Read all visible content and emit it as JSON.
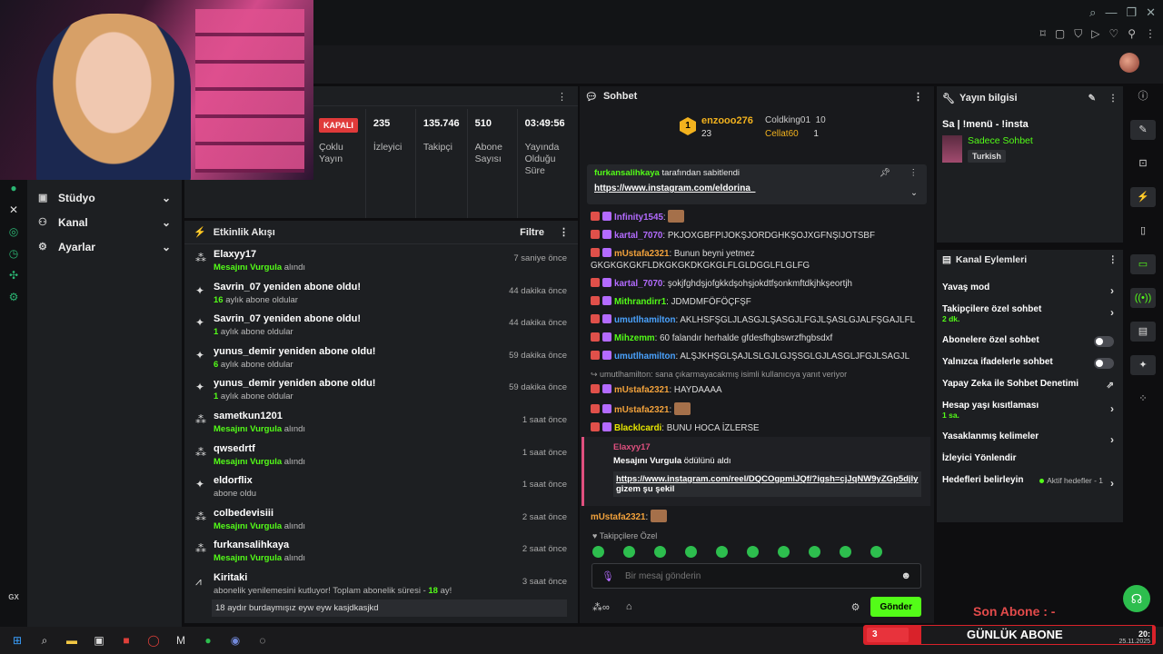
{
  "header": {
    "window_controls": [
      "search-icon",
      "minimize-icon",
      "restore-icon",
      "close-icon"
    ],
    "toolbar_icons": [
      "bookmark-icon",
      "clip-icon",
      "shield-icon",
      "play-icon",
      "heart-icon",
      "user-icon",
      "menu-icon"
    ]
  },
  "left_nav": {
    "items": [
      {
        "label": "Stüdyo",
        "icon": "video-icon"
      },
      {
        "label": "Kanal",
        "icon": "users-icon"
      },
      {
        "label": "Ayarlar",
        "icon": "gear-icon"
      }
    ],
    "rail_bottom": "GX"
  },
  "stats": {
    "status_badge": "KAPALI",
    "status_label": "Çoklu Yayın",
    "items": [
      {
        "value": "235",
        "label": "İzleyici"
      },
      {
        "value": "135.746",
        "label": "Takipçi"
      },
      {
        "value": "510",
        "label": "Abone Sayısı"
      },
      {
        "value": "03:49:56",
        "label": "Yayında Olduğu Süre"
      }
    ]
  },
  "activity": {
    "title": "Etkinlik Akışı",
    "filter_label": "Filtre",
    "rows": [
      {
        "name": "Elaxyy17",
        "hl": "Mesajını Vurgula",
        "rest": " alındı",
        "time": "7 saniye önce",
        "icon": "reward-icon"
      },
      {
        "name": "Savrin_07 yeniden abone oldu!",
        "hl": "16",
        "rest": " aylık abone oldular",
        "time": "44 dakika önce",
        "icon": "star-icon"
      },
      {
        "name": "Savrin_07 yeniden abone oldu!",
        "hl": "1",
        "rest": " aylık abone oldular",
        "time": "44 dakika önce",
        "icon": "star-icon"
      },
      {
        "name": "yunus_demir yeniden abone oldu!",
        "hl": "6",
        "rest": " aylık abone oldular",
        "time": "59 dakika önce",
        "icon": "star-icon"
      },
      {
        "name": "yunus_demir yeniden abone oldu!",
        "hl": "1",
        "rest": " aylık abone oldular",
        "time": "59 dakika önce",
        "icon": "star-icon"
      },
      {
        "name": "sametkun1201",
        "hl": "Mesajını Vurgula",
        "rest": " alındı",
        "time": "1 saat önce",
        "icon": "reward-icon"
      },
      {
        "name": "qwsedrtf",
        "hl": "Mesajını Vurgula",
        "rest": " alındı",
        "time": "1 saat önce",
        "icon": "reward-icon"
      },
      {
        "name": "eldorflix",
        "hl": "",
        "rest": "abone oldu",
        "time": "1 saat önce",
        "icon": "star-icon"
      },
      {
        "name": "colbedevisiii",
        "hl": "Mesajını Vurgula",
        "rest": " alındı",
        "time": "2 saat önce",
        "icon": "reward-icon"
      },
      {
        "name": "furkansalihkaya",
        "hl": "Mesajını Vurgula",
        "rest": " alındı",
        "time": "2 saat önce",
        "icon": "reward-icon"
      }
    ],
    "last": {
      "name": "Kiritaki",
      "text": "abonelik yenilemesini kutluyor! Toplam abonelik süresi - ",
      "months": "18",
      "suffix": " ay!",
      "time": "3 saat önce",
      "message": "18 aydır burdaymışız eyw eyw kasjdkasjkd"
    }
  },
  "chat": {
    "title": "Sohbet",
    "podium": {
      "first_rank": "1",
      "first_name": "enzooo276",
      "first_count": "23",
      "second_name": "Coldking01",
      "second_count": "10",
      "third_name": "Cellat60",
      "third_count": "1"
    },
    "pinned": {
      "author": "furkansalihkaya",
      "suffix": "tarafından sabitlendi",
      "url": "https://www.instagram.com/eldorina_"
    },
    "messages": [
      {
        "user": "Infinity1545",
        "uclass": "u-pur",
        "text": ""
      },
      {
        "user": "kartal_7070",
        "uclass": "u-pur",
        "text": "PKJOXGBFPIJOKŞJORDGHKŞOJXGFNŞIJOTSBF"
      },
      {
        "user": "mUstafa2321",
        "uclass": "u-ora",
        "text": "Bunun beyni yetmez GKGKGKGKFLDKGKGKDKGKGLFLGLDGGLFLGLFG"
      },
      {
        "user": "kartal_7070",
        "uclass": "u-pur",
        "text": "şokjfghdşjofgkkdşohşjokdtfşonkmftdkjhkşeortjh"
      },
      {
        "user": "Mithrandirr1",
        "uclass": "u-grn",
        "text": "JDMDMFÖFÖÇFŞF"
      },
      {
        "user": "umutlhamilton",
        "uclass": "u-blu",
        "text": "AKLHSFŞGLJLASGJLŞASGJLFGJLŞASLGJALFŞGAJLFL"
      },
      {
        "user": "Mihzemm",
        "uclass": "u-grn",
        "text": "60 falandır herhalde gfdesfhgbswrzfhgbsdxf"
      },
      {
        "user": "umutlhamilton",
        "uclass": "u-blu",
        "text": "ALŞJKHŞGLŞAJLSLGJLGJŞSGLGJLASGLJFGJLSAGJL"
      }
    ],
    "reply_note": "umutlhamilton: sana çıkarmayacakmış isimli kullanıcıya yanıt veriyor",
    "messages2": [
      {
        "user": "mUstafa2321",
        "uclass": "u-ora",
        "text": "HAYDAAAA"
      },
      {
        "user": "mUstafa2321",
        "uclass": "u-ora",
        "text": ""
      },
      {
        "user": "Blacklcardi",
        "uclass": "u-yel",
        "text": "BUNU HOCA İZLERSE"
      }
    ],
    "reward": {
      "user": "Elaxyy17",
      "title": "Mesajını Vurgula",
      "suffix": "ödülünü aldı",
      "url": "https://www.instagram.com/reel/DQCOgpmiJQf/?igsh=cjJqNW9yZGp5djly",
      "url_suffix": "gizem şu şekil"
    },
    "last_msg_user": "mUstafa2321",
    "follow_only": "Takipçilere Özel",
    "input_placeholder": "Bir mesaj gönderin",
    "send_label": "Gönder"
  },
  "stream_info": {
    "title": "Yayın bilgisi",
    "stream_title": "Sa | !menü - !insta",
    "category": "Sadece Sohbet",
    "tag": "Turkish"
  },
  "channel_actions": {
    "title": "Kanal Eylemleri",
    "items": [
      {
        "label": "Yavaş mod",
        "sub": "",
        "kind": "arrow"
      },
      {
        "label": "Takipçilere özel sohbet",
        "sub": "2 dk.",
        "kind": "arrow"
      },
      {
        "label": "Abonelere özel sohbet",
        "sub": "",
        "kind": "toggle"
      },
      {
        "label": "Yalnızca ifadelerle sohbet",
        "sub": "",
        "kind": "toggle"
      },
      {
        "label": "Yapay Zeka ile Sohbet Denetimi",
        "sub": "",
        "kind": "external"
      },
      {
        "label": "Hesap yaşı kısıtlaması",
        "sub": "1 sa.",
        "kind": "arrow"
      },
      {
        "label": "Yasaklanmış kelimeler",
        "sub": "",
        "kind": "arrow"
      },
      {
        "label": "İzleyici Yönlendir",
        "sub": "",
        "kind": "none"
      },
      {
        "label": "Hedefleri belirleyin",
        "sub": "",
        "kind": "goal",
        "extra": "Aktif hedefler - 1"
      }
    ]
  },
  "overlay": {
    "son_abone": "Son Abone : -",
    "daily_count": "3",
    "daily_label": "GÜNLÜK ABONE"
  },
  "taskbar": {
    "time": "20:",
    "date": "25.11.2025"
  },
  "colors": {
    "accent": "#53fc18",
    "alert": "#e03a3a",
    "panel": "#1d1f22"
  }
}
